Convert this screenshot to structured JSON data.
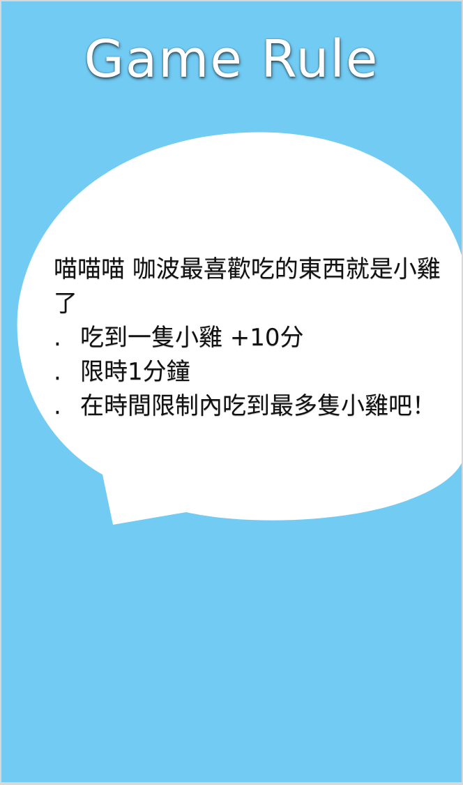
{
  "title": "Game Rule",
  "intro": "喵喵喵 咖波最喜歡吃的東西就是小雞了",
  "rules": [
    "吃到一隻小雞 +10分",
    "限時1分鐘",
    "在時間限制內吃到最多隻小雞吧！"
  ],
  "bullet": ".",
  "colors": {
    "background": "#72cbf3",
    "bubble": "#ffffff",
    "title": "#ffffff",
    "text": "#111111"
  }
}
